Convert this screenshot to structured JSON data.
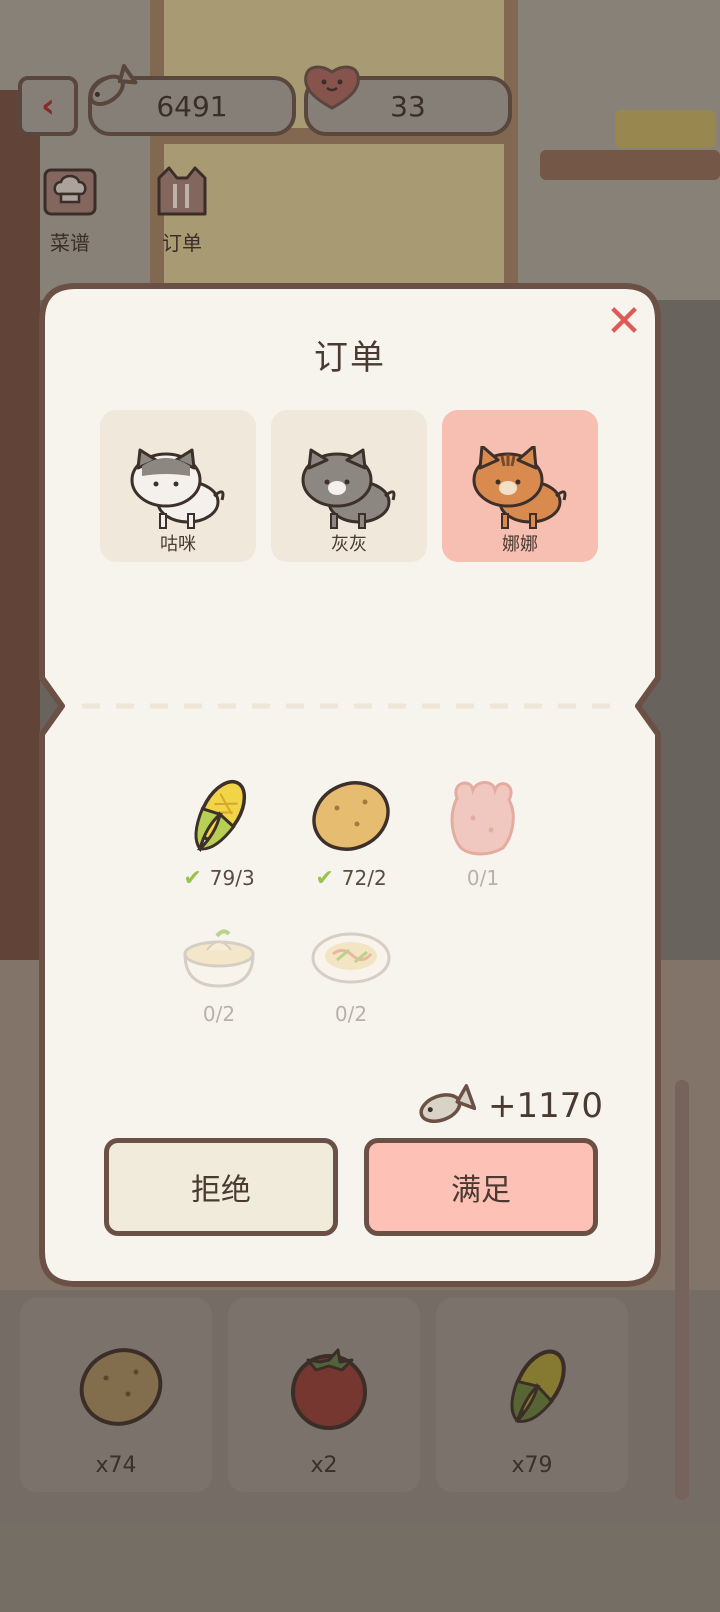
{
  "hud": {
    "fish_count": "6491",
    "heart_count": "33",
    "menu_buttons": [
      {
        "label": "菜谱",
        "icon": "chef-hat-icon"
      },
      {
        "label": "订单",
        "icon": "cat-fork-knife-icon"
      }
    ]
  },
  "modal": {
    "title": "订单",
    "close_icon": "close-x-icon",
    "customers": [
      {
        "name": "咕咪",
        "selected": false
      },
      {
        "name": "灰灰",
        "selected": false
      },
      {
        "name": "娜娜",
        "selected": true
      }
    ],
    "ingredients": [
      {
        "icon": "corn-icon",
        "count": "79/3",
        "satisfied": true
      },
      {
        "icon": "potato-icon",
        "count": "72/2",
        "satisfied": true
      },
      {
        "icon": "pink-bread-icon",
        "count": "0/1",
        "satisfied": false
      },
      {
        "icon": "mashed-potato-bowl-icon",
        "count": "0/2",
        "satisfied": false
      },
      {
        "icon": "noodle-plate-icon",
        "count": "0/2",
        "satisfied": false
      }
    ],
    "reward": "+1170",
    "reject_label": "拒绝",
    "accept_label": "满足"
  },
  "inventory": [
    {
      "icon": "potato-icon",
      "count": "x74"
    },
    {
      "icon": "tomato-icon",
      "count": "x2"
    },
    {
      "icon": "corn-icon",
      "count": "x79"
    }
  ],
  "colors": {
    "accent_pink": "#fdc1b5",
    "check_green": "#9bc24e",
    "close_red": "#e05a55"
  }
}
